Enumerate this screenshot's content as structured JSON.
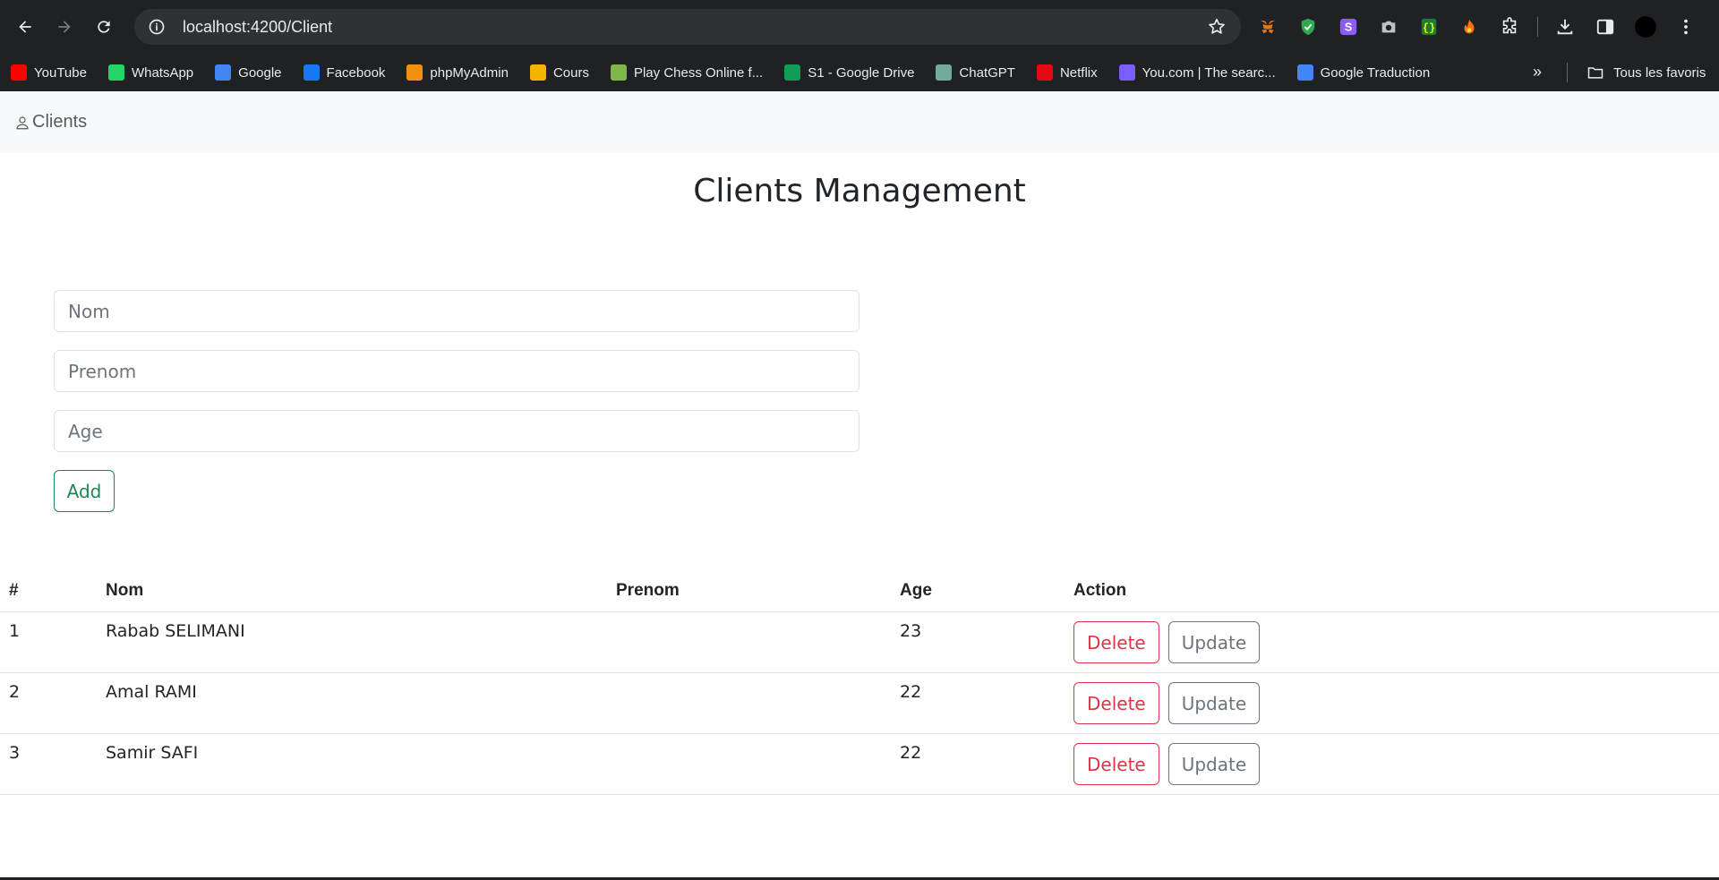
{
  "browser": {
    "url": "localhost:4200/Client",
    "bookmarks": [
      {
        "label": "YouTube",
        "icon": "youtube-icon",
        "color": "#ff0000"
      },
      {
        "label": "WhatsApp",
        "icon": "whatsapp-icon",
        "color": "#25d366"
      },
      {
        "label": "Google",
        "icon": "google-icon",
        "color": "#4285f4"
      },
      {
        "label": "Facebook",
        "icon": "facebook-icon",
        "color": "#1877f2"
      },
      {
        "label": "phpMyAdmin",
        "icon": "phpmyadmin-icon",
        "color": "#f29111"
      },
      {
        "label": "Cours",
        "icon": "classroom-icon",
        "color": "#f4b400"
      },
      {
        "label": "Play Chess Online f...",
        "icon": "chess-pawn-icon",
        "color": "#81b64c"
      },
      {
        "label": "S1 - Google Drive",
        "icon": "google-drive-icon",
        "color": "#0f9d58"
      },
      {
        "label": "ChatGPT",
        "icon": "chatgpt-icon",
        "color": "#74aa9c"
      },
      {
        "label": "Netflix",
        "icon": "netflix-icon",
        "color": "#e50914"
      },
      {
        "label": "You.com | The searc...",
        "icon": "you-com-icon",
        "color": "#7b5cff"
      },
      {
        "label": "Google Traduction",
        "icon": "google-translate-icon",
        "color": "#4285f4"
      }
    ],
    "all_bookmarks_label": "Tous les favoris"
  },
  "navbar": {
    "brand": "Clients"
  },
  "page": {
    "title": "Clients Management"
  },
  "form": {
    "nom_placeholder": "Nom",
    "prenom_placeholder": "Prenom",
    "age_placeholder": "Age",
    "add_label": "Add"
  },
  "table": {
    "headers": [
      "#",
      "Nom",
      "Prenom",
      "Age",
      "Action"
    ],
    "rows": [
      {
        "id": "1",
        "nom": "Rabab SELIMANI",
        "prenom": "",
        "age": "23"
      },
      {
        "id": "2",
        "nom": "Amal RAMI",
        "prenom": "",
        "age": "22"
      },
      {
        "id": "3",
        "nom": "Samir SAFI",
        "prenom": "",
        "age": "22"
      }
    ],
    "delete_label": "Delete",
    "update_label": "Update"
  }
}
